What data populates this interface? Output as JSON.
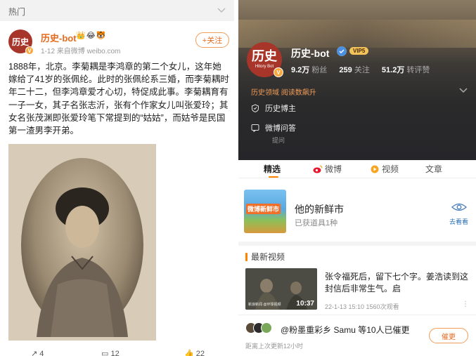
{
  "left": {
    "hot_label": "热门",
    "post": {
      "avatar_text": "历史",
      "author_name": "历史-bot",
      "author_badges": "👑😂🐯",
      "meta": "1-12  来自微博 weibo.com",
      "follow_label": "+关注",
      "text": "1888年，北京。李菊耦是李鸿章的第二个女儿，这年她嫁给了41岁的张佩纶。此时的张佩纶系三婚，而李菊耦时年二十二，但李鸿章爱才心切，特促成此事。李菊耦育有一子一女，其子名张志沂，张有个作家女儿叫张爱玲；其女名张茂渊即张爱玲笔下常提到的“姑姑”，而姑爷是民国第一渣男李开弟。",
      "actions": {
        "repost": "4",
        "comments": "12",
        "likes": "22"
      }
    }
  },
  "right": {
    "profile": {
      "avatar_text": "历史",
      "avatar_sub": "Hitory Bot",
      "name": "历史-bot",
      "vip_label": "VIP5",
      "stats": [
        {
          "value": "9.2万",
          "label": "粉丝"
        },
        {
          "value": "259",
          "label": "关注"
        },
        {
          "value": "51.2万",
          "label": "转评赞"
        }
      ],
      "domain_line": "历史领域  阅读数飙升",
      "tag_blogger": "历史博主",
      "tag_qa": "微博问答",
      "tag_qa_sub": "提问"
    },
    "tabs": [
      {
        "label": "精选"
      },
      {
        "label": "微博"
      },
      {
        "label": "视频"
      },
      {
        "label": "文章"
      }
    ],
    "market": {
      "thumb_label": "微博新鲜市",
      "title": "他的新鲜市",
      "subtitle": "已获道具1种",
      "action_label": "去看看"
    },
    "section_title": "最新视频",
    "video": {
      "duration": "10:37",
      "watermark": "新浪新闻 @环球视频",
      "title": "张令福死后，留下七个字。姜浩读到这封信后非常生气。启",
      "meta": "22-1-13 15:10 1560次观看",
      "more": "⋮"
    },
    "urge": {
      "text": "@粉墨重彩乡 Samu 等10人已催更",
      "time": "距离上次更新12小时",
      "button_label": "催更"
    }
  },
  "colors": {
    "accent_orange": "#e56a1d",
    "tab_underline": "#ff8200",
    "avatar_red": "#a8352a",
    "verify_gold": "#f7a73b"
  }
}
